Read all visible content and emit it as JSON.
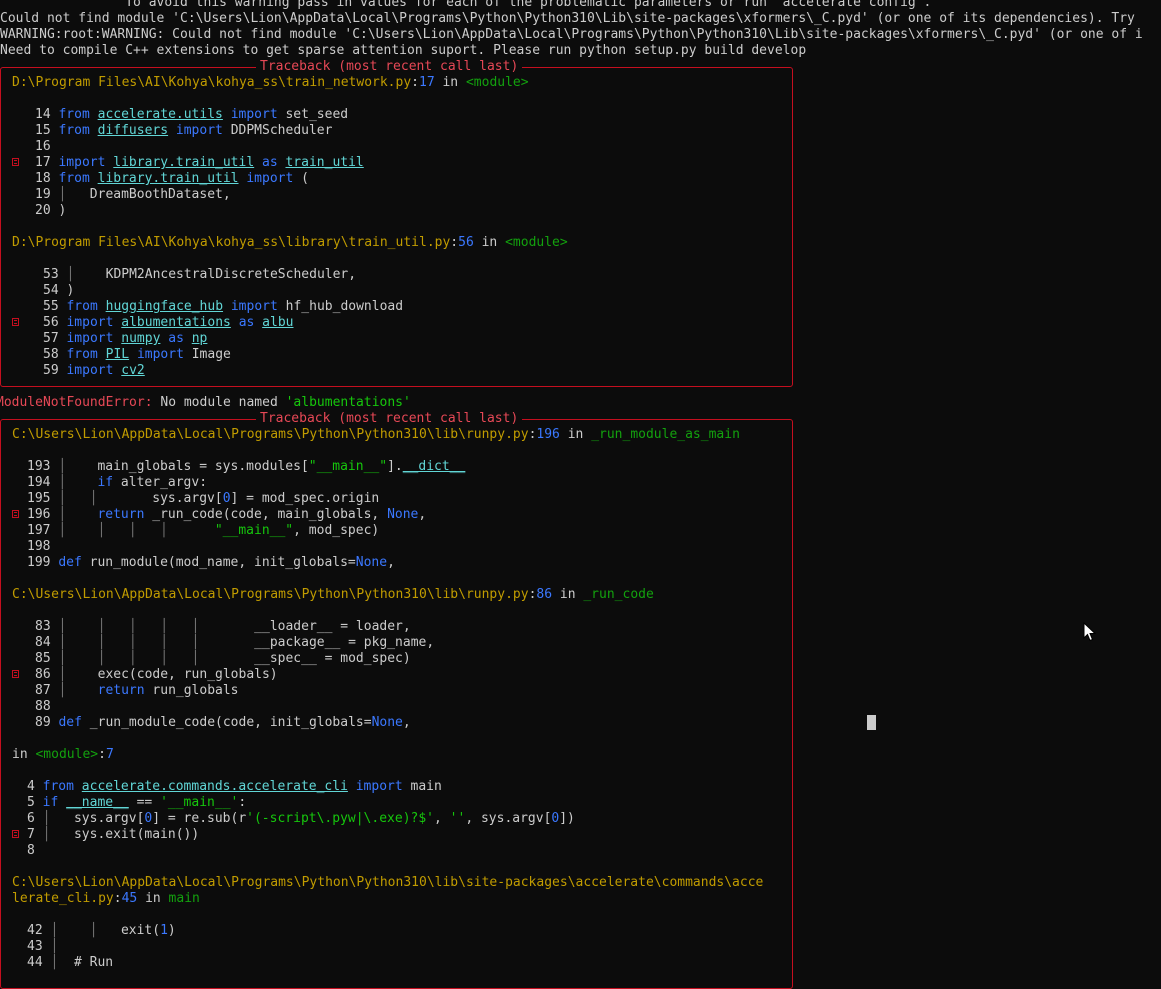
{
  "header": {
    "line1": "                To avoid this warning pass in values for each of the problematic parameters or run `accelerate config`.",
    "line2": "Could not find module 'C:\\Users\\Lion\\AppData\\Local\\Programs\\Python\\Python310\\Lib\\site-packages\\xformers\\_C.pyd' (or one of its dependencies). Try",
    "line3": "WARNING:root:WARNING: Could not find module 'C:\\Users\\Lion\\AppData\\Local\\Programs\\Python\\Python310\\Lib\\site-packages\\xformers\\_C.pyd' (or one of i",
    "line4": "Need to compile C++ extensions to get sparse attention suport. Please run python setup.py build develop"
  },
  "tb1": {
    "title": "Traceback (most recent call last)",
    "frame1": {
      "path": "D:\\Program Files\\AI\\Kohya\\kohya_ss\\train_network.py",
      "line": "17",
      "in": "in",
      "func": "<module>"
    },
    "frame2": {
      "path": "D:\\Program Files\\AI\\Kohya\\kohya_ss\\library\\train_util.py",
      "line": "56",
      "in": "in",
      "func": "<module>"
    }
  },
  "error": {
    "type": "ModuleNotFoundError:",
    "msg": " No module named ",
    "name": "'albumentations'"
  },
  "tb2": {
    "title": "Traceback (most recent call last)",
    "frame1": {
      "path": "C:\\Users\\Lion\\AppData\\Local\\Programs\\Python\\Python310\\lib\\runpy.py",
      "line": "196",
      "in": "in",
      "func": "_run_module_as_main"
    },
    "frame2": {
      "path": "C:\\Users\\Lion\\AppData\\Local\\Programs\\Python\\Python310\\lib\\runpy.py",
      "line": "86",
      "in": "in",
      "func": "_run_code"
    },
    "frame3": {
      "in": "in",
      "func": "<module>",
      "line": "7"
    },
    "frame4": {
      "path1": "C:\\Users\\Lion\\AppData\\Local\\Programs\\Python\\Python310\\lib\\site-packages\\accelerate\\commands\\acce",
      "path2": "lerate_cli.py",
      "line": "45",
      "in": "in",
      "func": "main"
    }
  },
  "code": {
    "l14": {
      "n": "14",
      "k1": "from",
      "m": "accelerate.utils",
      "k2": "import",
      "r": " set_seed"
    },
    "l15": {
      "n": "15",
      "k1": "from",
      "m": "diffusers",
      "k2": "import",
      "r": " DDPMScheduler"
    },
    "l16": {
      "n": "16"
    },
    "l17": {
      "n": "17",
      "k1": "import",
      "m": "library.train_util",
      "k2": "as",
      "a": "train_util"
    },
    "l18": {
      "n": "18",
      "k1": "from",
      "m": "library.train_util",
      "k2": "import",
      "r": " ("
    },
    "l19": {
      "n": "19",
      "r": "   DreamBoothDataset,"
    },
    "l20": {
      "n": "20",
      "r": ")"
    },
    "l53": {
      "n": "53",
      "r": "    KDPM2AncestralDiscreteScheduler,"
    },
    "l54": {
      "n": "54",
      "r": ")"
    },
    "l55": {
      "n": "55",
      "k1": "from",
      "m": "huggingface_hub",
      "k2": "import",
      "r": " hf_hub_download"
    },
    "l56": {
      "n": "56",
      "k1": "import",
      "m": "albumentations",
      "k2": "as",
      "a": "albu"
    },
    "l57": {
      "n": "57",
      "k1": "import",
      "m": "numpy",
      "k2": "as",
      "a": "np"
    },
    "l58": {
      "n": "58",
      "k1": "from",
      "m": "PIL",
      "k2": "import",
      "r": " Image"
    },
    "l59": {
      "n": "59",
      "k1": "import",
      "m": "cv2"
    },
    "l193": {
      "n": "193",
      "a": "    main_globals = sys.modules[",
      "s": "\"__main__\"",
      "b": "].",
      "c": "__dict__"
    },
    "l194": {
      "n": "194",
      "k": "if",
      "r": " alter_argv:"
    },
    "l195": {
      "n": "195",
      "a": "       sys.argv[",
      "num": "0",
      "r": "] = mod_spec.origin"
    },
    "l196": {
      "n": "196",
      "k": "return",
      "a": " _run_code(code, main_globals, ",
      "none": "None",
      "r": ","
    },
    "l197": {
      "n": "197",
      "s": "\"__main__\"",
      "r": ", mod_spec)"
    },
    "l198": {
      "n": "198"
    },
    "l199": {
      "n": "199",
      "k": "def",
      "f": "run_module",
      "a": "(mod_name, init_globals=",
      "none": "None",
      "r": ","
    },
    "l83": {
      "n": "83",
      "r": "__loader__ = loader,"
    },
    "l84": {
      "n": "84",
      "r": "__package__ = pkg_name,"
    },
    "l85": {
      "n": "85",
      "r": "__spec__ = mod_spec)"
    },
    "l86": {
      "n": "86",
      "r": "    exec(code, run_globals)"
    },
    "l87": {
      "n": "87",
      "k": "return",
      "r": " run_globals"
    },
    "l88": {
      "n": "88"
    },
    "l89": {
      "n": "89",
      "k": "def",
      "f": "_run_module_code",
      "a": "(code, init_globals=",
      "none": "None",
      "r": ","
    },
    "l4": {
      "n": "4",
      "k1": "from",
      "m": "accelerate.commands.accelerate_cli",
      "k2": "import",
      "r": " main"
    },
    "l5": {
      "n": "5",
      "k": "if",
      "d": "__name__",
      "a": " == ",
      "s": "'__main__'",
      "r": ":"
    },
    "l6": {
      "n": "6",
      "a": "   sys.argv[",
      "num": "0",
      "b": "] = re.sub(r",
      "s": "'(-script\\.pyw|\\.exe)?$'",
      "c": ", ",
      "s2": "''",
      "d": ", sys.argv[",
      "num2": "0",
      "r": "])"
    },
    "l7": {
      "n": "7",
      "r": "   sys.exit(main())"
    },
    "l8": {
      "n": "8"
    },
    "l42": {
      "n": "42",
      "a": "exit(",
      "num": "1",
      "r": ")"
    },
    "l43": {
      "n": "43"
    },
    "l44": {
      "n": "44",
      "r": "  # Run"
    }
  },
  "colors": {
    "border": "#c50f1f",
    "keyword": "#3b78ff",
    "module": "#61d6d6",
    "string": "#16c60c",
    "path": "#c19c00"
  }
}
